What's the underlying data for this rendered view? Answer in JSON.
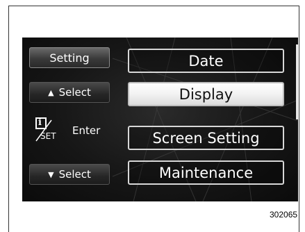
{
  "panel": {
    "title": "Setting",
    "select_up_label": "Select",
    "enter_label": "Enter",
    "select_down_label": "Select",
    "info_icon_letter": "i",
    "info_icon_sub": "SET"
  },
  "menu": {
    "items": [
      "Date",
      "Display",
      "Screen Setting",
      "Maintenance"
    ],
    "selected": "Display"
  },
  "figure_ref": "302065"
}
